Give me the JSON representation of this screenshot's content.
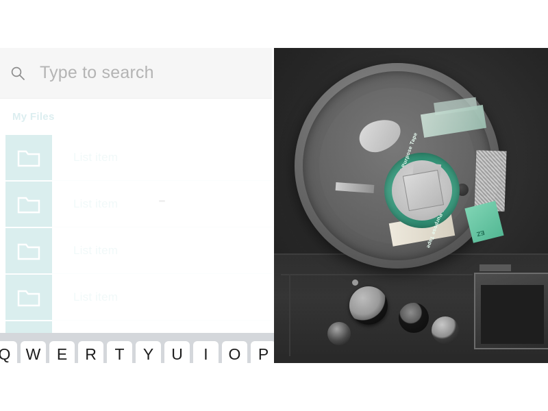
{
  "app": {
    "search": {
      "placeholder": "Type to search",
      "value": "",
      "icon": "search-icon"
    },
    "section_header": "My Files",
    "list_items": [
      {
        "label": "List item",
        "icon": "folder-icon"
      },
      {
        "label": "List item",
        "icon": "folder-icon"
      },
      {
        "label": "List item",
        "icon": "folder-icon"
      },
      {
        "label": "List item",
        "icon": "folder-icon"
      }
    ]
  },
  "keyboard": {
    "row": [
      "Q",
      "W",
      "E",
      "R",
      "T",
      "Y",
      "U",
      "I",
      "O",
      "P"
    ]
  },
  "photo": {
    "alt": "overhead grayscale photo of a multi-purpose tape reel on a dark camera deck",
    "reel_label_text": "Multi-Purpose Tape",
    "green_tag_text": "EZ"
  },
  "colors": {
    "accent_teal": "#daeeee",
    "search_bg": "#f6f6f6",
    "placeholder": "#b4b4b4",
    "keyboard_bg": "#d4d7db",
    "key_bg": "#ffffff",
    "photo_bg": "#2b2b2b",
    "label_green": "#2f8f73"
  }
}
